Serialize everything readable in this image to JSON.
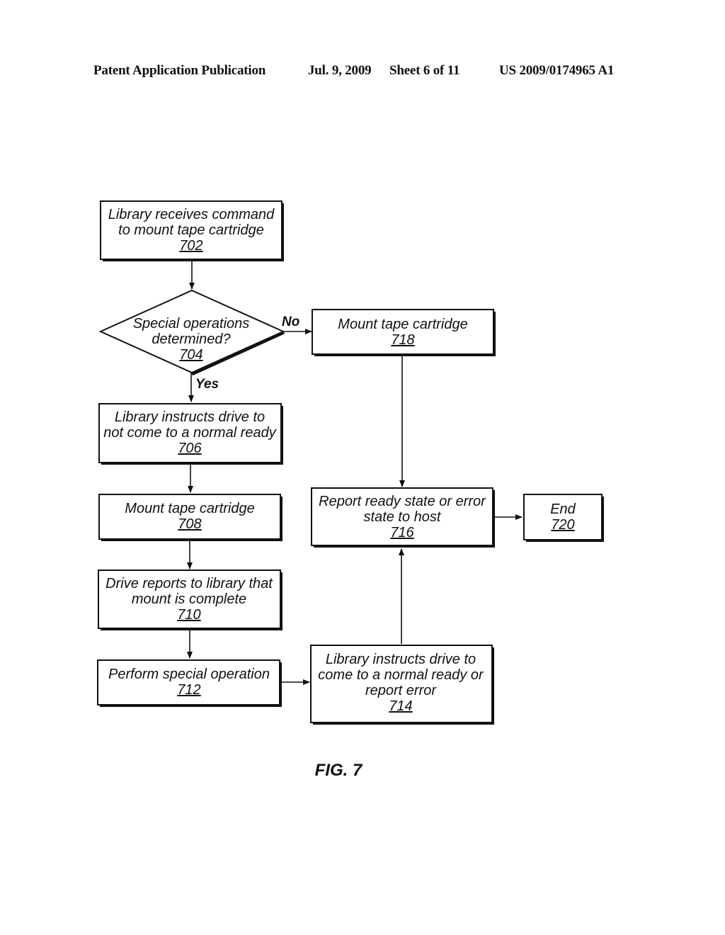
{
  "header": {
    "publication": "Patent Application Publication",
    "date": "Jul. 9, 2009",
    "sheet": "Sheet 6 of 11",
    "number": "US 2009/0174965 A1"
  },
  "figure_label": "FIG. 7",
  "nodes": {
    "n702": {
      "lines": [
        "Library receives command",
        "to mount tape cartridge"
      ],
      "ref": "702",
      "shape": "process"
    },
    "n704": {
      "lines": [
        "Special operations",
        "determined?"
      ],
      "ref": "704",
      "shape": "decision"
    },
    "n706": {
      "lines": [
        "Library instructs drive to",
        "not come to a normal ready"
      ],
      "ref": "706",
      "shape": "process"
    },
    "n708": {
      "lines": [
        "Mount tape cartridge"
      ],
      "ref": "708",
      "shape": "process"
    },
    "n710": {
      "lines": [
        "Drive reports to library that",
        "mount is complete"
      ],
      "ref": "710",
      "shape": "process"
    },
    "n712": {
      "lines": [
        "Perform special operation"
      ],
      "ref": "712",
      "shape": "process"
    },
    "n714": {
      "lines": [
        "Library instructs drive to",
        "come to a normal ready or",
        "report error"
      ],
      "ref": "714",
      "shape": "process"
    },
    "n716": {
      "lines": [
        "Report ready state or error",
        "state to host"
      ],
      "ref": "716",
      "shape": "process"
    },
    "n718": {
      "lines": [
        "Mount tape cartridge"
      ],
      "ref": "718",
      "shape": "process"
    },
    "n720": {
      "lines": [
        "End"
      ],
      "ref": "720",
      "shape": "process"
    }
  },
  "edges": [
    {
      "from": "702",
      "to": "704",
      "label": ""
    },
    {
      "from": "704",
      "to": "706",
      "label": "Yes"
    },
    {
      "from": "704",
      "to": "718",
      "label": "No"
    },
    {
      "from": "706",
      "to": "708",
      "label": ""
    },
    {
      "from": "708",
      "to": "710",
      "label": ""
    },
    {
      "from": "710",
      "to": "712",
      "label": ""
    },
    {
      "from": "712",
      "to": "714",
      "label": ""
    },
    {
      "from": "714",
      "to": "716",
      "label": ""
    },
    {
      "from": "718",
      "to": "716",
      "label": ""
    },
    {
      "from": "716",
      "to": "720",
      "label": ""
    }
  ],
  "edge_labels": {
    "yes": "Yes",
    "no": "No"
  }
}
